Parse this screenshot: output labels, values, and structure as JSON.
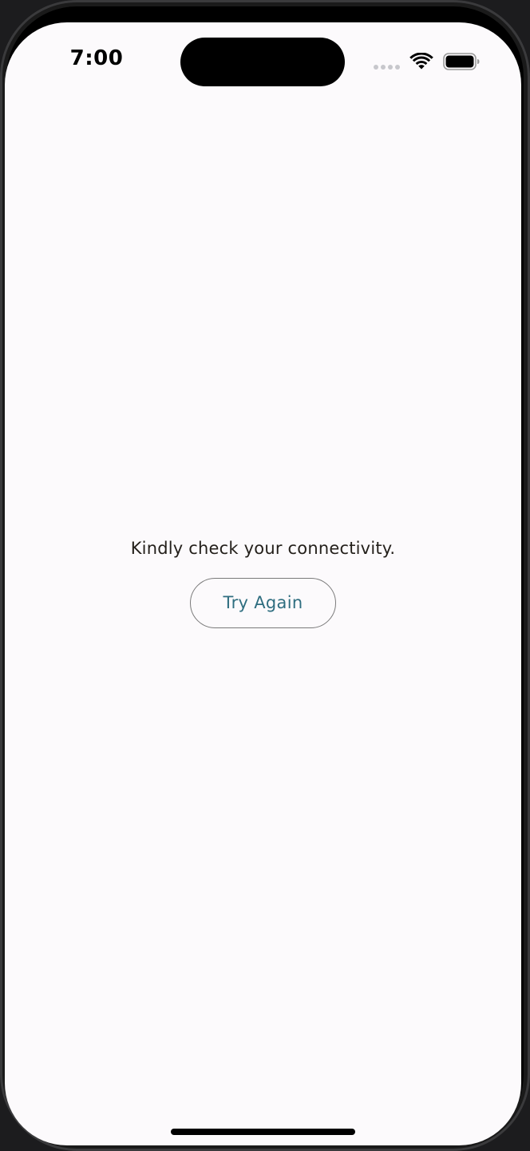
{
  "status_bar": {
    "time": "7:00",
    "icons": [
      "signal-dots-icon",
      "wifi-icon",
      "battery-icon"
    ]
  },
  "main": {
    "message": "Kindly check your connectivity.",
    "retry_label": "Try Again"
  },
  "colors": {
    "background": "#fcfafc",
    "message_text": "#231f1a",
    "button_text": "#2f6e80",
    "button_border": "#7a7a7a"
  }
}
